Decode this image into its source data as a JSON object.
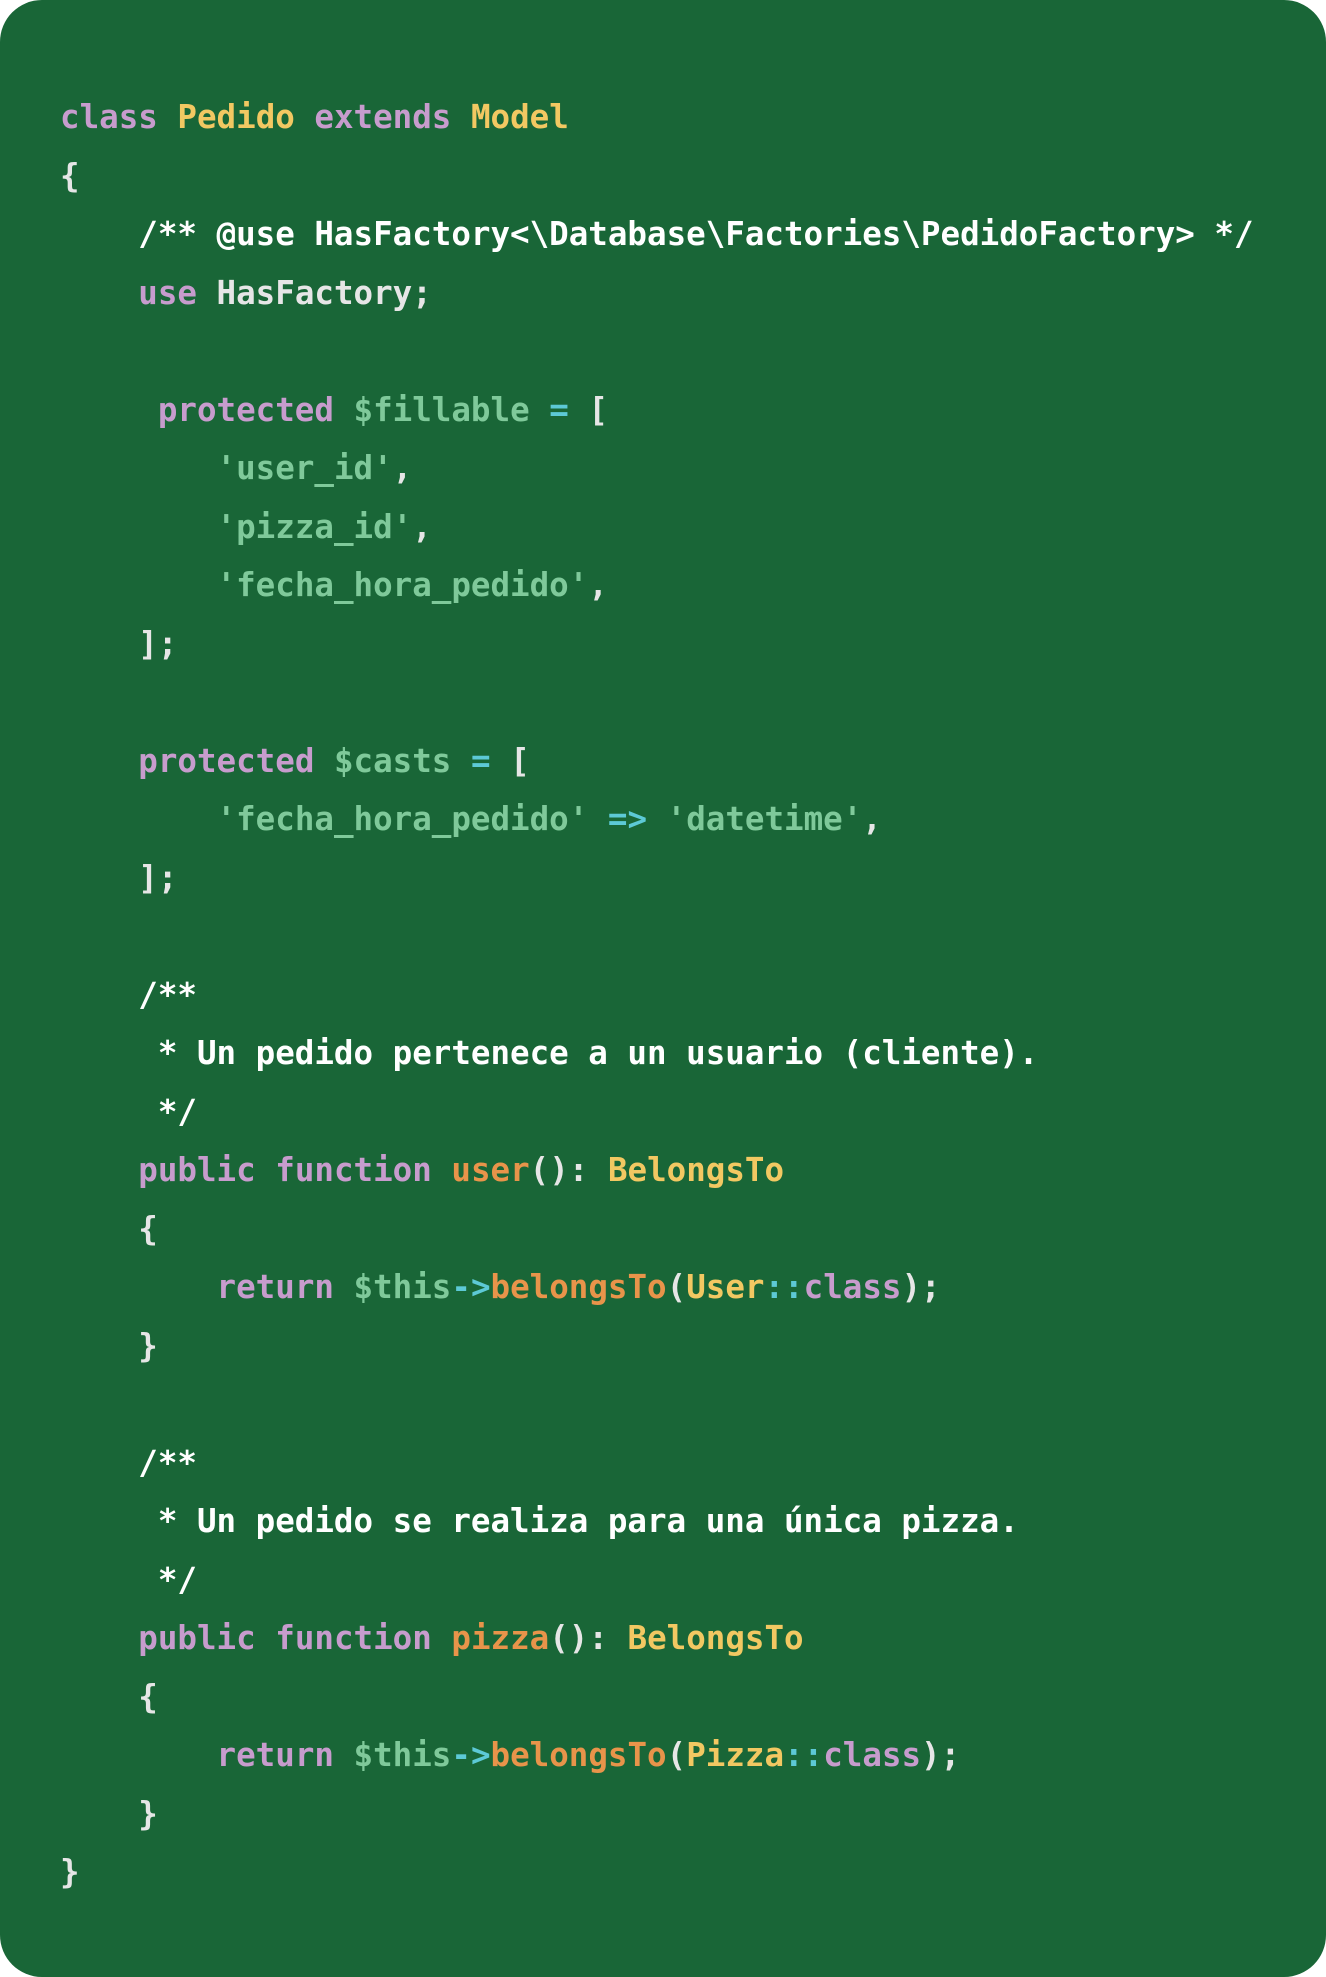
{
  "code": {
    "language": "php",
    "lines": [
      [
        {
          "t": "class",
          "k": "kw"
        },
        {
          "t": " ",
          "k": "pl"
        },
        {
          "t": "Pedido",
          "k": "cls"
        },
        {
          "t": " ",
          "k": "pl"
        },
        {
          "t": "extends",
          "k": "kw"
        },
        {
          "t": " ",
          "k": "pl"
        },
        {
          "t": "Model",
          "k": "cls"
        }
      ],
      [
        {
          "t": "{",
          "k": "pl"
        }
      ],
      [
        {
          "t": "    /** @use HasFactory<\\Database\\Factories\\PedidoFactory> */",
          "k": "cmt"
        }
      ],
      [
        {
          "t": "    ",
          "k": "pl"
        },
        {
          "t": "use",
          "k": "kw"
        },
        {
          "t": " HasFactory;",
          "k": "pl"
        }
      ],
      [],
      [
        {
          "t": "     ",
          "k": "pl"
        },
        {
          "t": "protected",
          "k": "kw"
        },
        {
          "t": " ",
          "k": "pl"
        },
        {
          "t": "$fillable",
          "k": "var"
        },
        {
          "t": " ",
          "k": "pl"
        },
        {
          "t": "=",
          "k": "op"
        },
        {
          "t": " [",
          "k": "pl"
        }
      ],
      [
        {
          "t": "        ",
          "k": "pl"
        },
        {
          "t": "'user_id'",
          "k": "str"
        },
        {
          "t": ",",
          "k": "pl"
        }
      ],
      [
        {
          "t": "        ",
          "k": "pl"
        },
        {
          "t": "'pizza_id'",
          "k": "str"
        },
        {
          "t": ",",
          "k": "pl"
        }
      ],
      [
        {
          "t": "        ",
          "k": "pl"
        },
        {
          "t": "'fecha_hora_pedido'",
          "k": "str"
        },
        {
          "t": ",",
          "k": "pl"
        }
      ],
      [
        {
          "t": "    ];",
          "k": "pl"
        }
      ],
      [],
      [
        {
          "t": "    ",
          "k": "pl"
        },
        {
          "t": "protected",
          "k": "kw"
        },
        {
          "t": " ",
          "k": "pl"
        },
        {
          "t": "$casts",
          "k": "var"
        },
        {
          "t": " ",
          "k": "pl"
        },
        {
          "t": "=",
          "k": "op"
        },
        {
          "t": " [",
          "k": "pl"
        }
      ],
      [
        {
          "t": "        ",
          "k": "pl"
        },
        {
          "t": "'fecha_hora_pedido'",
          "k": "str"
        },
        {
          "t": " ",
          "k": "pl"
        },
        {
          "t": "=>",
          "k": "op"
        },
        {
          "t": " ",
          "k": "pl"
        },
        {
          "t": "'datetime'",
          "k": "str"
        },
        {
          "t": ",",
          "k": "pl"
        }
      ],
      [
        {
          "t": "    ];",
          "k": "pl"
        }
      ],
      [],
      [
        {
          "t": "    /**",
          "k": "cmt"
        }
      ],
      [
        {
          "t": "     * Un pedido pertenece a un usuario (cliente).",
          "k": "cmt"
        }
      ],
      [
        {
          "t": "     */",
          "k": "cmt"
        }
      ],
      [
        {
          "t": "    ",
          "k": "pl"
        },
        {
          "t": "public",
          "k": "kw"
        },
        {
          "t": " ",
          "k": "pl"
        },
        {
          "t": "function",
          "k": "kw"
        },
        {
          "t": " ",
          "k": "pl"
        },
        {
          "t": "user",
          "k": "fn"
        },
        {
          "t": "(): ",
          "k": "pl"
        },
        {
          "t": "BelongsTo",
          "k": "cls"
        }
      ],
      [
        {
          "t": "    {",
          "k": "pl"
        }
      ],
      [
        {
          "t": "        ",
          "k": "pl"
        },
        {
          "t": "return",
          "k": "kw"
        },
        {
          "t": " ",
          "k": "pl"
        },
        {
          "t": "$this",
          "k": "var"
        },
        {
          "t": "->",
          "k": "op"
        },
        {
          "t": "belongsTo",
          "k": "fn"
        },
        {
          "t": "(",
          "k": "pl"
        },
        {
          "t": "User",
          "k": "cls"
        },
        {
          "t": "::",
          "k": "op"
        },
        {
          "t": "class",
          "k": "kw"
        },
        {
          "t": ");",
          "k": "pl"
        }
      ],
      [
        {
          "t": "    }",
          "k": "pl"
        }
      ],
      [],
      [
        {
          "t": "    /**",
          "k": "cmt"
        }
      ],
      [
        {
          "t": "     * Un pedido se realiza para una única pizza.",
          "k": "cmt"
        }
      ],
      [
        {
          "t": "     */",
          "k": "cmt"
        }
      ],
      [
        {
          "t": "    ",
          "k": "pl"
        },
        {
          "t": "public",
          "k": "kw"
        },
        {
          "t": " ",
          "k": "pl"
        },
        {
          "t": "function",
          "k": "kw"
        },
        {
          "t": " ",
          "k": "pl"
        },
        {
          "t": "pizza",
          "k": "fn"
        },
        {
          "t": "(): ",
          "k": "pl"
        },
        {
          "t": "BelongsTo",
          "k": "cls"
        }
      ],
      [
        {
          "t": "    {",
          "k": "pl"
        }
      ],
      [
        {
          "t": "        ",
          "k": "pl"
        },
        {
          "t": "return",
          "k": "kw"
        },
        {
          "t": " ",
          "k": "pl"
        },
        {
          "t": "$this",
          "k": "var"
        },
        {
          "t": "->",
          "k": "op"
        },
        {
          "t": "belongsTo",
          "k": "fn"
        },
        {
          "t": "(",
          "k": "pl"
        },
        {
          "t": "Pizza",
          "k": "cls"
        },
        {
          "t": "::",
          "k": "op"
        },
        {
          "t": "class",
          "k": "kw"
        },
        {
          "t": ");",
          "k": "pl"
        }
      ],
      [
        {
          "t": "    }",
          "k": "pl"
        }
      ],
      [
        {
          "t": "}",
          "k": "pl"
        }
      ]
    ]
  },
  "colors": {
    "background": "#196637",
    "keyword": "#c79ccd",
    "class_name": "#f2c862",
    "plain": "#e6e6e6",
    "comment": "#ffffff",
    "variable": "#7fc99a",
    "string": "#7fc99a",
    "operator": "#5dc9d6",
    "function_name": "#e8944a"
  }
}
